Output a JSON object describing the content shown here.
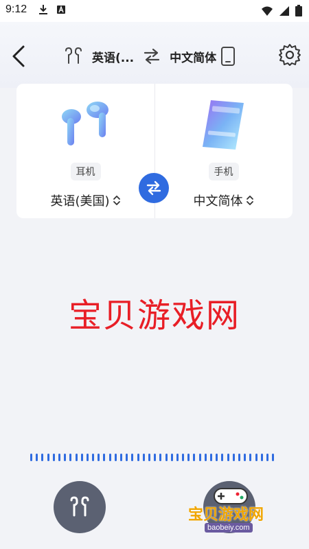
{
  "status_bar": {
    "time": "9:12",
    "icons": [
      "download-icon",
      "text-a-icon",
      "wifi-icon",
      "signal-icon",
      "battery-icon"
    ]
  },
  "header": {
    "source_lang": "英语(...",
    "target_lang": "中文简体",
    "icons": [
      "back-arrow-icon",
      "earbuds-icon",
      "swap-arrows-icon",
      "phone-icon",
      "gear-icon"
    ]
  },
  "card": {
    "left": {
      "device_label": "耳机",
      "language": "英语(美国)"
    },
    "right": {
      "device_label": "手机",
      "language": "中文简体"
    }
  },
  "main": {
    "watermark": "宝贝游戏网"
  },
  "bottom": {
    "logo_text": "宝贝游戏网",
    "logo_url": "baobeiy.com"
  },
  "colors": {
    "accent": "#2f6be0",
    "watermark": "#e81e26",
    "button_bg": "#5b6172"
  }
}
